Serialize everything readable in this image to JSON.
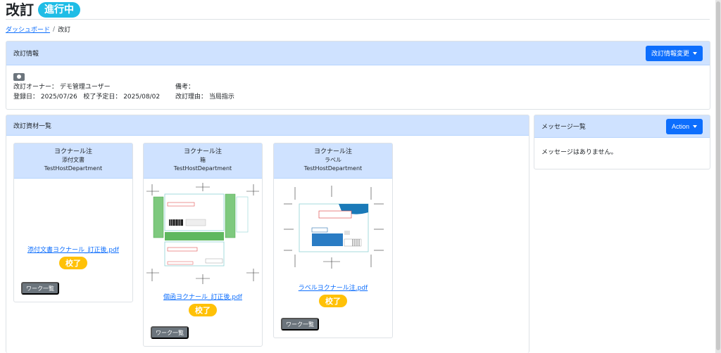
{
  "header": {
    "title": "改訂",
    "status": "進行中"
  },
  "breadcrumb": {
    "home": "ダッシュボード",
    "separator": "/",
    "current": "改訂"
  },
  "revision_info": {
    "title": "改訂情報",
    "change_button": "改訂情報変更",
    "owner": "改訂オーナー： デモ管理ユーザー",
    "registered": "登録日： 2025/07/26",
    "proof_due": "校了予定日： 2025/08/02",
    "remarks": "備考：",
    "reason": "改訂理由： 当局指示"
  },
  "materials": {
    "title": "改訂資材一覧",
    "items": [
      {
        "company": "ヨクナール注",
        "type": "添付文書",
        "department": "TestHostDepartment",
        "file": "添付文書ヨクナール_訂正後.pdf",
        "status": "校了",
        "work_button": "ワーク一覧"
      },
      {
        "company": "ヨクナール注",
        "type": "箱",
        "department": "TestHostDepartment",
        "file": "個函ヨクナール_訂正後.pdf",
        "status": "校了",
        "work_button": "ワーク一覧"
      },
      {
        "company": "ヨクナール注",
        "type": "ラベル",
        "department": "TestHostDepartment",
        "file": "ラベルヨクナール注.pdf",
        "status": "校了",
        "work_button": "ワーク一覧"
      }
    ]
  },
  "messages": {
    "title": "メッセージ一覧",
    "action_button": "Action",
    "empty": "メッセージはありません。"
  },
  "colors": {
    "primary": "#0d6efd",
    "header_bg": "#cfe2ff",
    "status_pill": "#20bde6",
    "proof_badge": "#ffc107",
    "secondary": "#6c757d"
  }
}
